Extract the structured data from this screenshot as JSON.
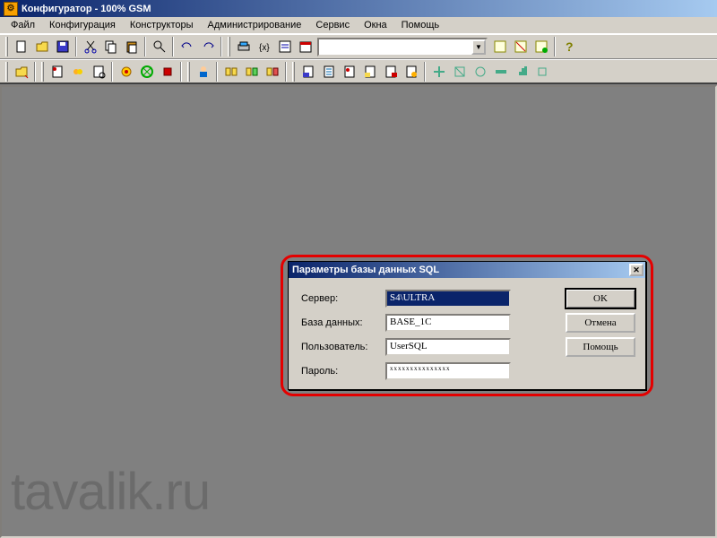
{
  "title": "Конфигуратор - 100% GSM",
  "menu": [
    "Файл",
    "Конфигурация",
    "Конструкторы",
    "Администрирование",
    "Сервис",
    "Окна",
    "Помощь"
  ],
  "toolbar": {
    "combo_value": "",
    "icons1": [
      "new",
      "open",
      "save",
      "cut",
      "copy",
      "paste",
      "find",
      "undo",
      "redo",
      "run",
      "syntax",
      "debug",
      "combo",
      "filter1",
      "filter2",
      "filter3",
      "tree",
      "help"
    ],
    "icons2": [
      "cfg",
      "mod1",
      "mod2",
      "mod3",
      "col1",
      "col2",
      "col3",
      "usr",
      "grp1",
      "grp2",
      "grp3",
      "doc1",
      "doc2",
      "doc3",
      "doc4",
      "doc5",
      "doc6",
      "act1",
      "act2",
      "act3",
      "act4",
      "act5"
    ]
  },
  "dialog": {
    "title": "Параметры базы данных SQL",
    "labels": {
      "server": "Сервер:",
      "db": "База данных:",
      "user": "Пользователь:",
      "pwd": "Пароль:"
    },
    "values": {
      "server": "S4\\ULTRA",
      "db": "BASE_1C",
      "user": "UserSQL",
      "pwd": "xxxxxxxxxxxxxxx"
    },
    "buttons": {
      "ok": "OK",
      "cancel": "Отмена",
      "help": "Помощь"
    }
  },
  "watermark": "tavalik.ru"
}
